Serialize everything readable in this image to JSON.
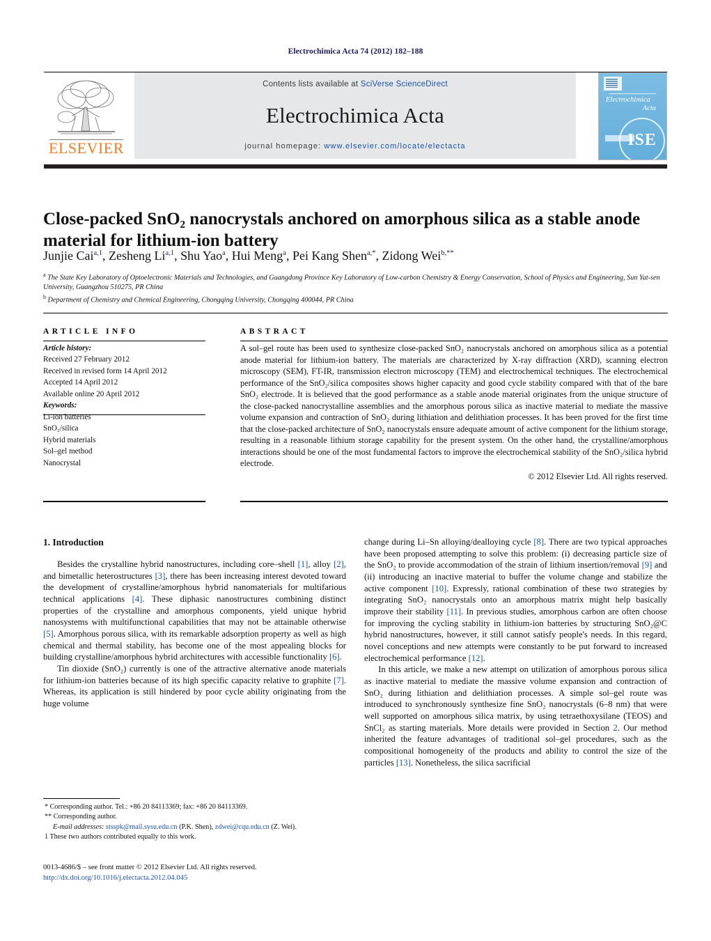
{
  "running_head": "Electrochimica Acta 74 (2012) 182–188",
  "masthead": {
    "contents_prefix": "Contents lists available at ",
    "sciencedirect_link": "SciVerse ScienceDirect",
    "journal_title": "Electrochimica Acta",
    "homepage_prefix": "journal homepage: ",
    "homepage_url": "www.elsevier.com/locate/electacta",
    "publisher_name": "ELSEVIER",
    "cover": {
      "line1": "Electrochimica",
      "line2": "Acta",
      "society_mark": "ISE"
    }
  },
  "article": {
    "title": "Close-packed SnO₂ nanocrystals anchored on amorphous silica as a stable anode material for lithium-ion battery",
    "authors_html": "Junjie Cai<sup>a,1</sup>, Zesheng Li<sup>a,1</sup>, Shu Yao<sup>a</sup>, Hui Meng<sup>a</sup>, Pei Kang Shen<sup>a,*</sup>, Zidong Wei<sup>b,**</sup>",
    "affiliation_a": "The State Key Laboratory of Optoelectronic Materials and Technologies, and Guangdong Province Key Laboratory of Low-carbon Chemistry & Energy Conservation, School of Physics and Engineering, Sun Yat-sen University, Guangzhou 510275, PR China",
    "affiliation_b": "Department of Chemistry and Chemical Engineering, Chongqing University, Chongqing 400044, PR China"
  },
  "article_info": {
    "label": "ARTICLE INFO",
    "history_heading": "Article history:",
    "history": [
      "Received 27 February 2012",
      "Received in revised form 14 April 2012",
      "Accepted 14 April 2012",
      "Available online 20 April 2012"
    ],
    "keywords_heading": "Keywords:",
    "keywords": [
      "Li-ion batteries",
      "SnO₂/silica",
      "Hybrid materials",
      "Sol–gel method",
      "Nanocrystal"
    ]
  },
  "abstract": {
    "label": "ABSTRACT",
    "text": "A sol–gel route has been used to synthesize close-packed SnO₂ nanocrystals anchored on amorphous silica as a potential anode material for lithium-ion battery. The materials are characterized by X-ray diffraction (XRD), scanning electron microscopy (SEM), FT-IR, transmission electron microscopy (TEM) and electrochemical techniques. The electrochemical performance of the SnO₂/silica composites shows higher capacity and good cycle stability compared with that of the bare SnO₂ electrode. It is believed that the good performance as a stable anode material originates from the unique structure of the close-packed nanocrystalline assemblies and the amorphous porous silica as inactive material to mediate the massive volume expansion and contraction of SnO₂ during lithiation and delithiation processes. It has been proved for the first time that the close-packed architecture of SnO₂ nanocrystals ensure adequate amount of active component for the lithium storage, resulting in a reasonable lithium storage capability for the present system. On the other hand, the crystalline/amorphous interactions should be one of the most fundamental factors to improve the electrochemical stability of the SnO₂/silica hybrid electrode.",
    "copyright": "© 2012 Elsevier Ltd. All rights reserved."
  },
  "body": {
    "section_heading": "1. Introduction",
    "left_paragraphs": [
      "Besides the crystalline hybrid nanostructures, including core–shell [1], alloy [2], and bimetallic heterostructures [3], there has been increasing interest devoted toward the development of crystalline/amorphous hybrid nanomaterials for multifarious technical applications [4]. These diphasic nanostructures combining distinct properties of the crystalline and amorphous components, yield unique hybrid nanosystems with multifunctional capabilities that may not be attainable otherwise [5]. Amorphous porous silica, with its remarkable adsorption property as well as high chemical and thermal stability, has become one of the most appealing blocks for building crystalline/amorphous hybrid architectures with accessible functionality [6].",
      "Tin dioxide (SnO₂) currently is one of the attractive alternative anode materials for lithium-ion batteries because of its high specific capacity relative to graphite [7]. Whereas, its application is still hindered by poor cycle ability originating from the huge volume"
    ],
    "right_paragraphs": [
      "change during Li–Sn alloying/dealloying cycle [8]. There are two typical approaches have been proposed attempting to solve this problem: (i) decreasing particle size of the SnO₂ to provide accommodation of the strain of lithium insertion/removal [9] and (ii) introducing an inactive material to buffer the volume change and stabilize the active component [10]. Expressly, rational combination of these two strategies by integrating SnO₂ nanocrystals onto an amorphous matrix might help basically improve their stability [11]. In previous studies, amorphous carbon are often choose for improving the cycling stability in lithium-ion batteries by structuring SnO₂@C hybrid nanostructures, however, it still cannot satisfy people's needs. In this regard, novel conceptions and new attempts were constantly to be put forward to increased electrochemical performance [12].",
      "In this article, we make a new attempt on utilization of amorphous porous silica as inactive material to mediate the massive volume expansion and contraction of SnO₂ during lithiation and delithiation processes. A simple sol–gel route was introduced to synchronously synthesize fine SnO₂ nanocrystals (6–8 nm) that were well supported on amorphous silica matrix, by using tetraethoxysilane (TEOS) and SnCl₂ as starting materials. More details were provided in Section 2. Our method inherited the feature advantages of traditional sol–gel procedures, such as the compositional homogeneity of the products and ability to control the size of the particles [13]. Nonetheless, the silica sacrificial"
    ]
  },
  "footnotes": {
    "corresponding_1": "* Corresponding author. Tel.: +86 20 84113369; fax: +86 20 84113369.",
    "corresponding_2": "** Corresponding author.",
    "email_label": "E-mail addresses:",
    "email_1": "stsspk@mail.sysu.edu.cn",
    "email_1_owner": "(P.K. Shen),",
    "email_2": "zdwei@cqu.edu.cn",
    "email_2_owner": "(Z. Wei).",
    "equal_contrib": "1  These two authors contributed equally to this work."
  },
  "imprint": {
    "issn_line": "0013-4686/$ – see front matter © 2012 Elsevier Ltd. All rights reserved.",
    "doi": "http://dx.doi.org/10.1016/j.electacta.2012.04.045"
  }
}
